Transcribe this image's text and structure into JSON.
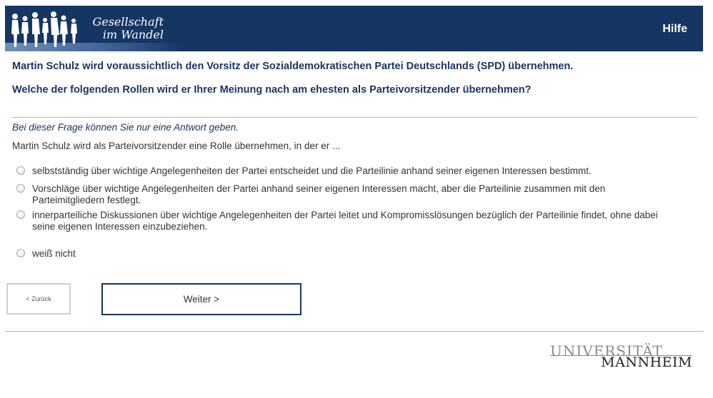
{
  "header": {
    "logo_line1": "Gesellschaft",
    "logo_line2": "im Wandel",
    "help_label": "Hilfe",
    "bg_color": "#153563"
  },
  "question": {
    "intro": "Martin Schulz wird voraussichtlich den Vorsitz der Sozialdemokratischen Partei Deutschlands (SPD) übernehmen.",
    "text": "Welche der folgenden Rollen wird er Ihrer Meinung nach am ehesten als Parteivorsitzender übernehmen?",
    "hint": "Bei dieser Frage können Sie nur eine Antwort geben.",
    "stem": "Martin Schulz wird als Parteivorsitzender eine Rolle übernehmen, in der er ..."
  },
  "options": [
    {
      "line1": "selbstständig über wichtige Angelegenheiten der Partei entscheidet und die Parteilinie anhand seiner eigenen Interessen bestimmt.",
      "line2": "",
      "selected": false
    },
    {
      "line1": "Vorschläge über wichtige Angelegenheiten der Partei anhand seiner eigenen Interessen macht, aber die Parteilinie zusammen mit den",
      "line2": "Parteimitgliedern festlegt.",
      "selected": false
    },
    {
      "line1": "innerparteiliche Diskussionen über wichtige Angelegenheiten der Partei leitet und Kompromisslösungen bezüglich der Parteilinie findet, ohne dabei",
      "line2": "seine eigenen Interessen einzubeziehen.",
      "selected": false
    },
    {
      "line1": "weiß nicht",
      "line2": "",
      "selected": false
    }
  ],
  "navigation": {
    "back_label": "< Zurück",
    "next_label": "Weiter >"
  },
  "footer": {
    "uni_line1": "UNIVERSITÄT",
    "uni_line2": "MANNHEIM"
  }
}
